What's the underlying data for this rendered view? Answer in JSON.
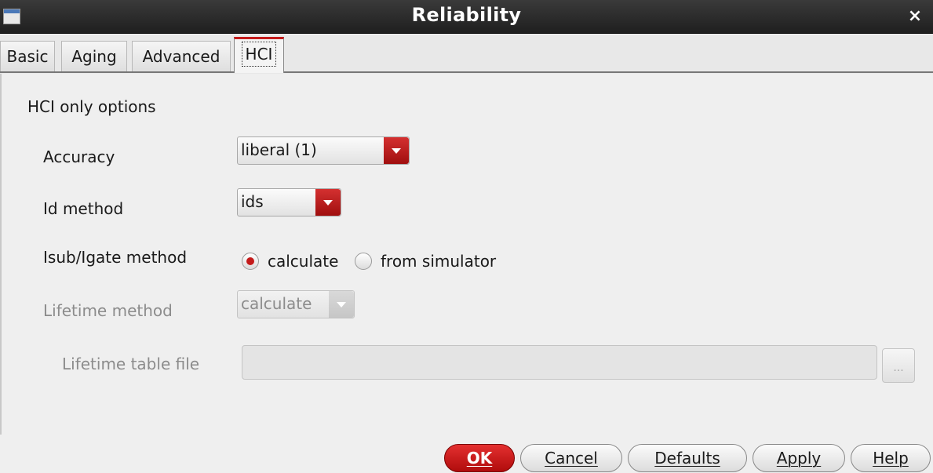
{
  "window": {
    "title": "Reliability",
    "close_glyph": "×"
  },
  "tabs": [
    {
      "label": "Basic"
    },
    {
      "label": "Aging"
    },
    {
      "label": "Advanced"
    },
    {
      "label": "HCI",
      "active": true
    }
  ],
  "hci": {
    "section_title": "HCI only options",
    "accuracy": {
      "label": "Accuracy",
      "value": "liberal (1)"
    },
    "id_method": {
      "label": "Id method",
      "value": "ids"
    },
    "isub_method": {
      "label": "Isub/Igate method",
      "options": [
        "calculate",
        "from simulator"
      ],
      "selected": "calculate"
    },
    "lifetime_method": {
      "label": "Lifetime method",
      "value": "calculate",
      "disabled": true
    },
    "lifetime_table_file": {
      "label": "Lifetime table file",
      "value": "",
      "browse_label": "...",
      "disabled": true
    }
  },
  "buttons": {
    "ok": "OK",
    "cancel": "Cancel",
    "defaults": "Defaults",
    "apply": "Apply",
    "help": "Help"
  },
  "colors": {
    "accent": "#c41a1a",
    "titlebar": "#2a2a2a"
  }
}
